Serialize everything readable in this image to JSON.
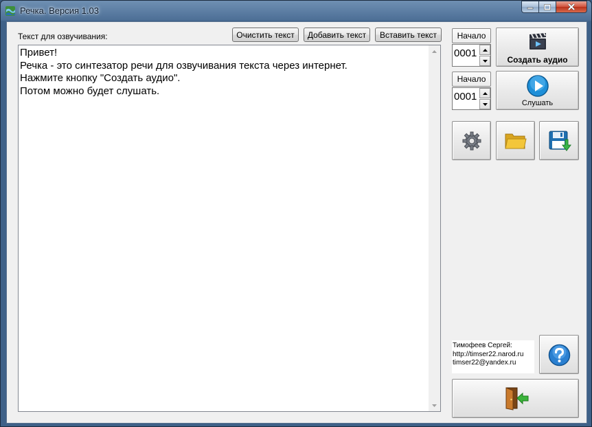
{
  "window": {
    "title": "Речка. Версия 1.03",
    "icons": {
      "app": "river-app-icon",
      "minimize": "minimize-icon",
      "maximize": "maximize-icon",
      "close": "close-icon"
    }
  },
  "editor": {
    "label": "Текст для озвучивания:",
    "buttons": {
      "clear": "Очистить текст",
      "add": "Добавить текст",
      "paste": "Вставить текст"
    },
    "lines": [
      "Привет!",
      "Речка - это синтезатор речи для озвучивания текста через интернет.",
      "Нажмите кнопку \"Создать аудио\".",
      "Потом можно будет слушать."
    ]
  },
  "panel": {
    "start_label_1": "Начало",
    "start_value_1": "0001",
    "create_audio": "Создать аудио",
    "start_label_2": "Начало",
    "start_value_2": "0001",
    "listen": "Слушать",
    "icons": {
      "create": "clapperboard-icon",
      "listen": "play-icon",
      "settings": "gear-icon",
      "open": "folder-icon",
      "save": "floppy-save-icon",
      "help": "help-icon",
      "exit": "exit-door-icon"
    }
  },
  "author": {
    "name": "Тимофеев Сергей:",
    "site": "http://timser22.narod.ru",
    "email": "timser22@yandex.ru"
  },
  "colors": {
    "play_blue": "#1e8fd8",
    "help_blue": "#2a7fd0",
    "folder_yellow": "#f3c63a",
    "exit_green": "#3bb33b"
  }
}
